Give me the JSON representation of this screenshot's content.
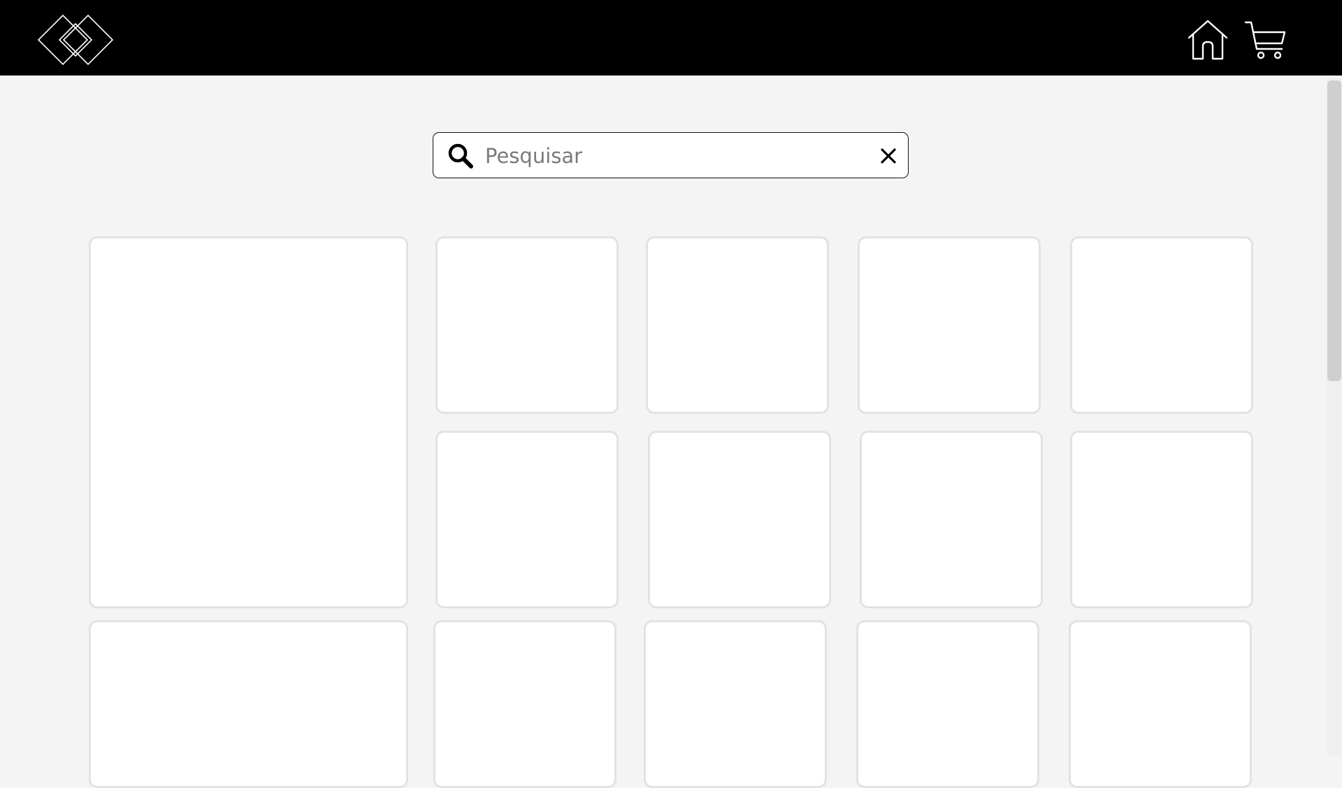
{
  "header": {
    "logo_name": "diamonds-logo",
    "nav_icons": [
      "home-icon",
      "cart-icon"
    ],
    "background": "#000000"
  },
  "search": {
    "placeholder": "Pesquisar",
    "value": ""
  },
  "products": {
    "rows": 3,
    "cards_visible": 15,
    "card_background": "#ffffff",
    "card_border": "#e2e2e2"
  },
  "page": {
    "background": "#f4f4f4"
  }
}
